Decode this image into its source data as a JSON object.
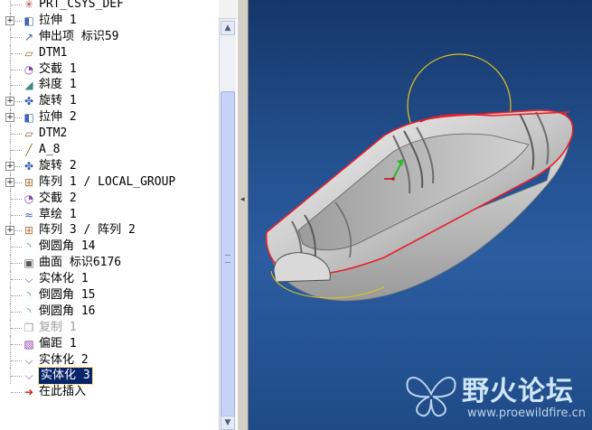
{
  "model_tree": {
    "items": [
      {
        "label": "PRT_CSYS_DEF",
        "icon": "csys-icon",
        "icon_glyph": "✳",
        "expandable": false
      },
      {
        "label": "拉伸 1",
        "icon": "extrude-icon",
        "icon_glyph": "◧",
        "expandable": true
      },
      {
        "label": "伸出项 标识59",
        "icon": "protrusion-icon",
        "icon_glyph": "↗",
        "expandable": false
      },
      {
        "label": "DTM1",
        "icon": "datum-plane-icon",
        "icon_glyph": "▱",
        "expandable": false
      },
      {
        "label": "交截 1",
        "icon": "intersect-icon",
        "icon_glyph": "◔",
        "expandable": false
      },
      {
        "label": "斜度 1",
        "icon": "draft-icon",
        "icon_glyph": "◢",
        "expandable": false
      },
      {
        "label": "旋转 1",
        "icon": "revolve-icon",
        "icon_glyph": "✤",
        "expandable": true
      },
      {
        "label": "拉伸 2",
        "icon": "extrude-icon",
        "icon_glyph": "◧",
        "expandable": true
      },
      {
        "label": "DTM2",
        "icon": "datum-plane-icon",
        "icon_glyph": "▱",
        "expandable": false
      },
      {
        "label": "A_8",
        "icon": "datum-axis-icon",
        "icon_glyph": "╱",
        "expandable": false
      },
      {
        "label": "旋转 2",
        "icon": "revolve-icon",
        "icon_glyph": "✤",
        "expandable": true
      },
      {
        "label": "阵列 1 / LOCAL_GROUP",
        "icon": "pattern-icon",
        "icon_glyph": "⊞",
        "expandable": true
      },
      {
        "label": "交截 2",
        "icon": "intersect-icon",
        "icon_glyph": "◔",
        "expandable": false
      },
      {
        "label": "草绘 1",
        "icon": "sketch-icon",
        "icon_glyph": "≈",
        "expandable": false
      },
      {
        "label": "阵列 3 / 阵列 2",
        "icon": "pattern-icon",
        "icon_glyph": "⊞",
        "expandable": true
      },
      {
        "label": "倒圆角 14",
        "icon": "round-icon",
        "icon_glyph": "◝",
        "expandable": false
      },
      {
        "label": "曲面 标识6176",
        "icon": "surface-icon",
        "icon_glyph": "▣",
        "expandable": false
      },
      {
        "label": "实体化 1",
        "icon": "solidify-icon",
        "icon_glyph": "⌵",
        "expandable": false
      },
      {
        "label": "倒圆角 15",
        "icon": "round-icon",
        "icon_glyph": "◝",
        "expandable": false
      },
      {
        "label": "倒圆角 16",
        "icon": "round-icon",
        "icon_glyph": "◝",
        "expandable": false
      },
      {
        "label": "复制 1",
        "icon": "copy-icon",
        "icon_glyph": "❐",
        "expandable": false,
        "dimmed": true
      },
      {
        "label": "偏距 1",
        "icon": "offset-icon",
        "icon_glyph": "▧",
        "expandable": false
      },
      {
        "label": "实体化 2",
        "icon": "solidify-icon",
        "icon_glyph": "⌵",
        "expandable": false
      },
      {
        "label": "实体化 3",
        "icon": "solidify-icon",
        "icon_glyph": "⌵",
        "expandable": false,
        "selected": true
      },
      {
        "label": "在此插入",
        "icon": "insert-here-arrow-icon",
        "icon_glyph": "➔",
        "expandable": false
      }
    ]
  },
  "scrollbar": {
    "up_glyph": "▲",
    "down_glyph": "▼"
  },
  "splitter": {
    "grip_glyph": "◂"
  },
  "viewport": {
    "background_top": "#16366a",
    "background_bottom": "#2b5da0",
    "edge_highlight_color": "#e8202a",
    "sketch_curve_color": "#e0c419"
  },
  "watermark": {
    "title": "野火论坛",
    "url": "www.proewildfire.cn"
  },
  "colors": {
    "selection_bg": "#0a246a",
    "selection_fg": "#ffffff",
    "dimmed_text": "#a0a0a0"
  }
}
